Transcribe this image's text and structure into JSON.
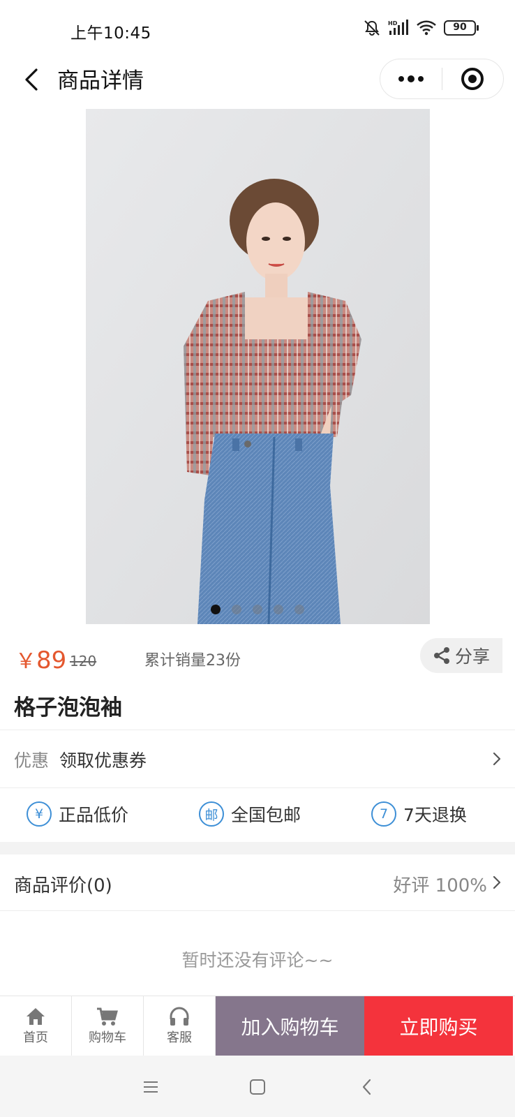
{
  "status_bar": {
    "time": "上午10:45",
    "battery": "90",
    "icons": [
      "bell-off-icon",
      "hd-signal-icon",
      "wifi-icon",
      "battery-icon"
    ]
  },
  "nav": {
    "title": "商品详情",
    "back_icon": "chevron-left-icon",
    "more_icon": "more-dots-icon",
    "close_icon": "target-circle-icon"
  },
  "gallery": {
    "image": "model wearing plaid puff-sleeve crop top and blue jeans",
    "slide_count": 5,
    "active_slide": 0
  },
  "product": {
    "currency": "￥",
    "price": "89",
    "original_price": "120",
    "sales_text": "累计销量23份",
    "share_label": "分享",
    "name": "格子泡泡袖"
  },
  "coupon": {
    "label": "优惠",
    "text": "领取优惠券"
  },
  "guarantees": [
    {
      "icon": "¥",
      "text": "正品低价"
    },
    {
      "icon": "邮",
      "text": "全国包邮"
    },
    {
      "icon": "7",
      "text": "7天退换"
    }
  ],
  "reviews": {
    "title": "商品评价(0)",
    "rate": "好评 100%",
    "empty_text": "暂时还没有评论~~"
  },
  "action_bar": {
    "home": "首页",
    "cart": "购物车",
    "service": "客服",
    "add_to_cart": "加入购物车",
    "buy_now": "立即购买"
  },
  "colors": {
    "price": "#e4572e",
    "add_to_cart_bg": "#85768c",
    "buy_now_bg": "#f4333c",
    "guarantee_icon": "#3d8fd6"
  }
}
